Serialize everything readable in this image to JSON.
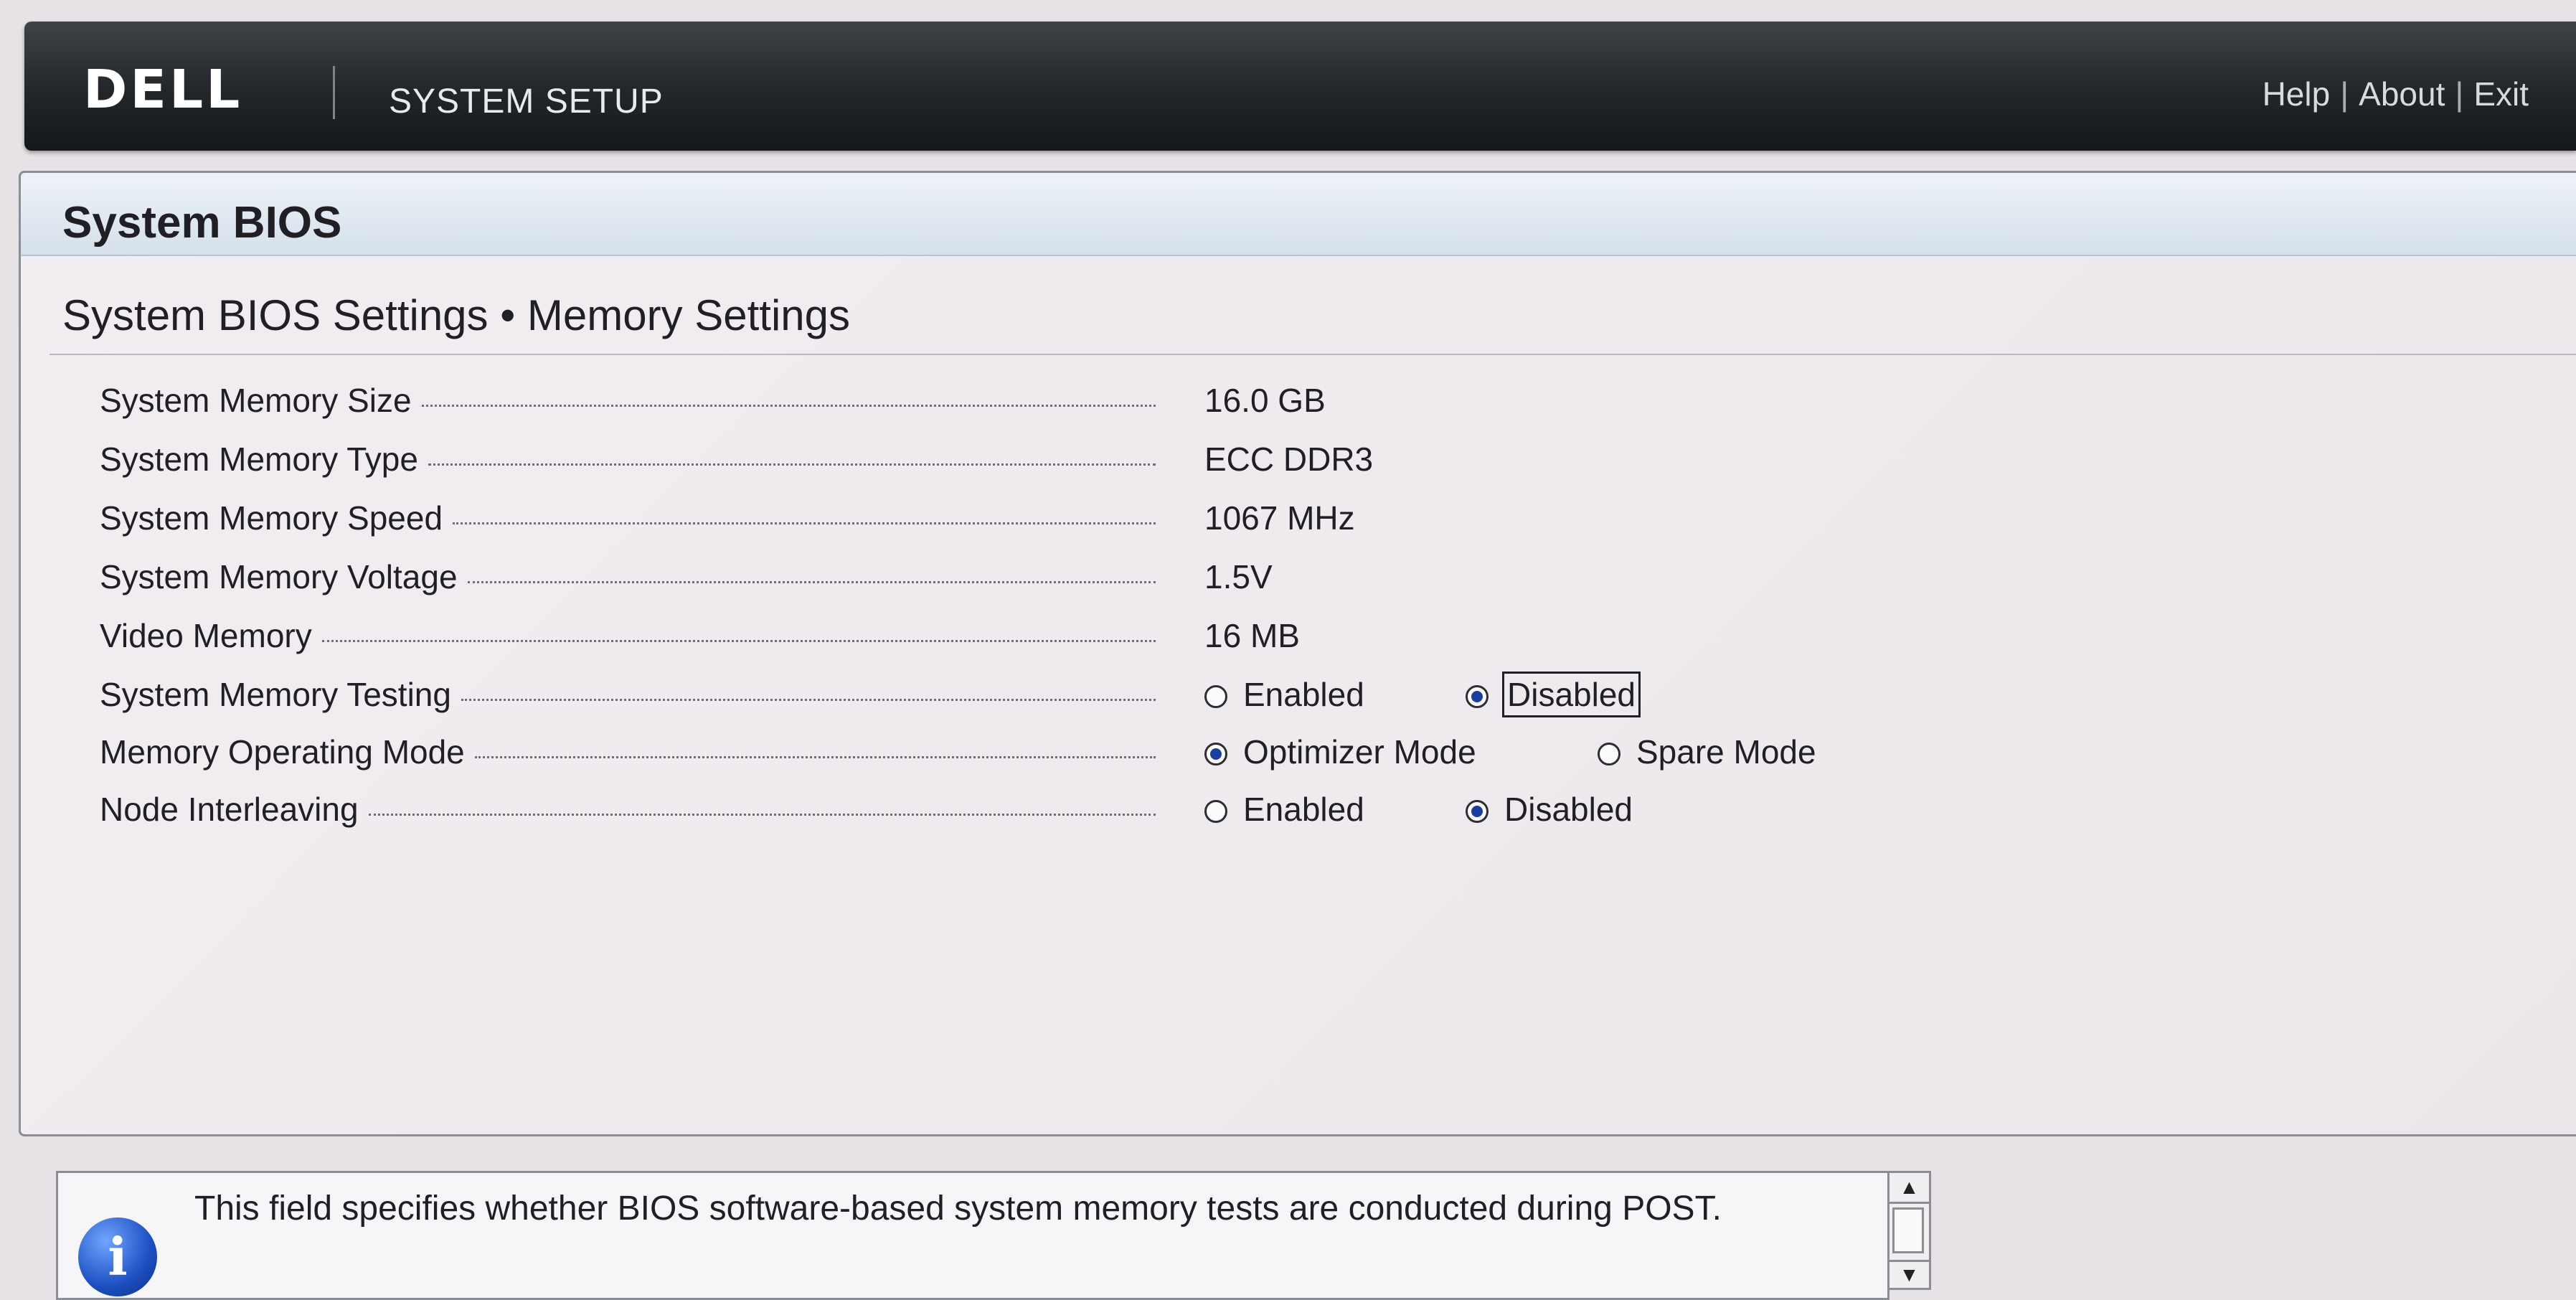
{
  "header": {
    "logo_text": "DELL",
    "app_title": "SYSTEM SETUP",
    "nav": {
      "help": "Help",
      "about": "About",
      "exit": "Exit",
      "separator": "|"
    }
  },
  "panel": {
    "title": "System BIOS",
    "breadcrumb": "System BIOS Settings • Memory Settings"
  },
  "settings": [
    {
      "label": "System Memory Size",
      "value": "16.0 GB"
    },
    {
      "label": "System Memory Type",
      "value": "ECC DDR3"
    },
    {
      "label": "System Memory Speed",
      "value": "1067 MHz"
    },
    {
      "label": "System Memory Voltage",
      "value": "1.5V"
    },
    {
      "label": "Video Memory",
      "value": "16 MB"
    },
    {
      "label": "System Memory Testing",
      "options": [
        "Enabled",
        "Disabled"
      ],
      "selected": "Disabled"
    },
    {
      "label": "Memory Operating Mode",
      "options": [
        "Optimizer Mode",
        "Spare Mode"
      ],
      "selected": "Optimizer Mode"
    },
    {
      "label": "Node Interleaving",
      "options": [
        "Enabled",
        "Disabled"
      ],
      "selected": "Disabled"
    }
  ],
  "help": {
    "icon": "info-icon",
    "icon_glyph": "i",
    "text": "This field specifies whether BIOS software-based system memory tests are conducted during POST."
  },
  "colors": {
    "topbar": "#22262a",
    "radio_selected": "#1a3f9c",
    "header_band": "#d5e0ea"
  }
}
